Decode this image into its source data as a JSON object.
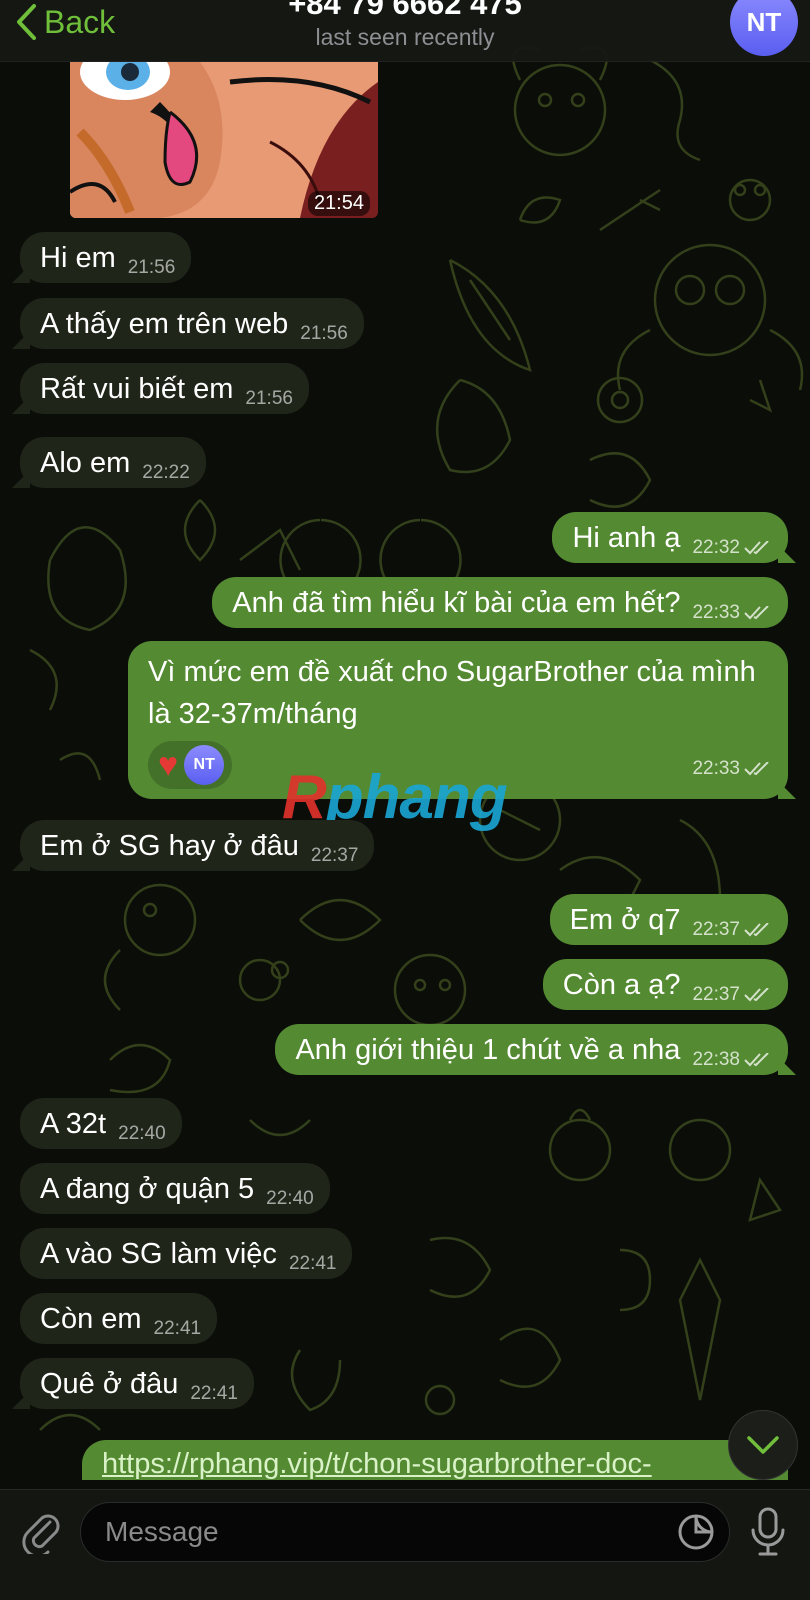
{
  "header": {
    "back_label": "Back",
    "contact_name": "+84 79 6662 475",
    "status": "last seen recently",
    "avatar_initials": "NT"
  },
  "sticker": {
    "time": "21:54"
  },
  "messages": [
    {
      "text": "Hi em",
      "time": "21:56",
      "dir": "in"
    },
    {
      "text": "A thấy em trên web",
      "time": "21:56",
      "dir": "in"
    },
    {
      "text": "Rất vui biết em",
      "time": "21:56",
      "dir": "in"
    },
    {
      "text": "Alo em",
      "time": "22:22",
      "dir": "in"
    },
    {
      "text": "Hi anh ạ",
      "time": "22:32",
      "dir": "out"
    },
    {
      "text": "Anh đã tìm hiểu kĩ bài của em hết?",
      "time": "22:33",
      "dir": "out"
    },
    {
      "text": "Vì mức em đề xuất cho SugarBrother của mình là 32-37m/tháng",
      "time": "22:33",
      "dir": "out",
      "reaction": "♥",
      "reaction_avatar": "NT"
    },
    {
      "text": "Em ở SG hay ở đâu",
      "time": "22:37",
      "dir": "in"
    },
    {
      "text": "Em ở q7",
      "time": "22:37",
      "dir": "out"
    },
    {
      "text": "Còn a ạ?",
      "time": "22:37",
      "dir": "out"
    },
    {
      "text": "Anh giới thiệu 1 chút về a nha",
      "time": "22:38",
      "dir": "out"
    },
    {
      "text": "A 32t",
      "time": "22:40",
      "dir": "in"
    },
    {
      "text": "A đang ở quận 5",
      "time": "22:40",
      "dir": "in"
    },
    {
      "text": "A vào SG làm việc",
      "time": "22:41",
      "dir": "in"
    },
    {
      "text": "Còn em",
      "time": "22:41",
      "dir": "in"
    },
    {
      "text": "Quê ở đâu",
      "time": "22:41",
      "dir": "in"
    }
  ],
  "link_preview": "https://rphang.vip/t/chon-sugarbrother-doc-",
  "watermark": {
    "r": "R",
    "rest": "phang"
  },
  "input": {
    "placeholder": "Message"
  },
  "colors": {
    "outgoing": "#548a32",
    "incoming": "#1f2519",
    "accent": "#6fbf3a"
  }
}
